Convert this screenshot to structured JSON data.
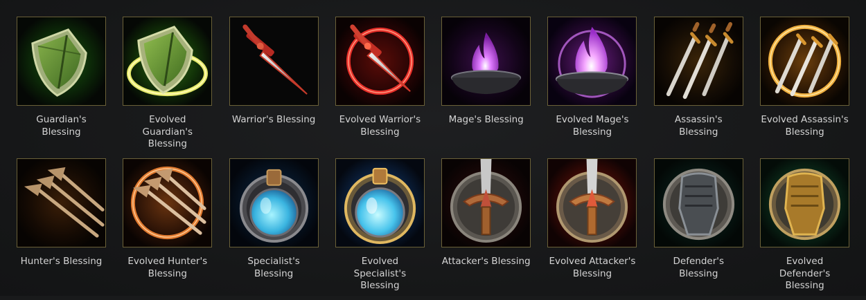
{
  "tiles": [
    {
      "label": "Guardian's Blessing",
      "icon": "shield-icon"
    },
    {
      "label": "Evolved Guardian's Blessing",
      "icon": "shield-ring-icon"
    },
    {
      "label": "Warrior's Blessing",
      "icon": "sword-icon"
    },
    {
      "label": "Evolved Warrior's Blessing",
      "icon": "sword-ring-icon"
    },
    {
      "label": "Mage's Blessing",
      "icon": "flame-brazier-icon"
    },
    {
      "label": "Evolved Mage's Blessing",
      "icon": "flame-brazier-bright-icon"
    },
    {
      "label": "Assassin's Blessing",
      "icon": "triple-daggers-icon"
    },
    {
      "label": "Evolved Assassin's Blessing",
      "icon": "triple-daggers-ring-icon"
    },
    {
      "label": "Hunter's Blessing",
      "icon": "arrows-icon"
    },
    {
      "label": "Evolved Hunter's Blessing",
      "icon": "arrows-ring-icon"
    },
    {
      "label": "Specialist's Blessing",
      "icon": "potion-flask-icon"
    },
    {
      "label": "Evolved Specialist's Blessing",
      "icon": "potion-flask-glow-icon"
    },
    {
      "label": "Attacker's Blessing",
      "icon": "sword-medallion-icon"
    },
    {
      "label": "Evolved Attacker's Blessing",
      "icon": "sword-medallion-glow-icon"
    },
    {
      "label": "Defender's Blessing",
      "icon": "gauntlet-medallion-icon"
    },
    {
      "label": "Evolved Defender's Blessing",
      "icon": "gauntlet-medallion-gold-icon"
    }
  ],
  "colors": {
    "page_background": "#191a1b",
    "frame_border": "#6b6138",
    "label_text": "#d4d4d4"
  }
}
